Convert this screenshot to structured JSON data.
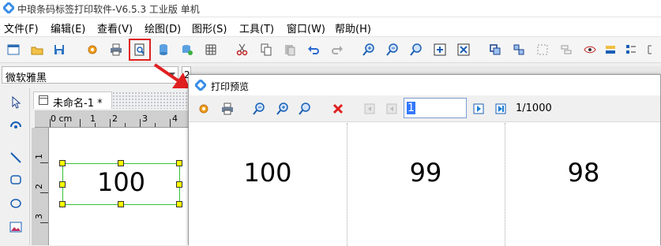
{
  "window": {
    "title": "中琅条码标签打印软件-V6.5.3 工业版 单机"
  },
  "menu": [
    "文件(F)",
    "编辑(E)",
    "查看(V)",
    "绘图(D)",
    "图形(S)",
    "工具(T)",
    "窗口(W)",
    "帮助(H)"
  ],
  "font": {
    "name": "微软雅黑",
    "size_partial": "2"
  },
  "document": {
    "tab_title": "未命名-1 *"
  },
  "ruler": {
    "unit": "0 cm",
    "marks": [
      "1",
      "2",
      "3",
      "4"
    ],
    "v_marks": [
      "1",
      "2",
      "3"
    ]
  },
  "canvas": {
    "label_text": "100"
  },
  "preview": {
    "title": "打印预览",
    "page_input": "1",
    "page_count": "1/1000",
    "labels": [
      "100",
      "99",
      "98"
    ]
  },
  "colors": {
    "highlight": "#e02020",
    "selection_border": "#36c136",
    "handle": "#ffff00"
  }
}
